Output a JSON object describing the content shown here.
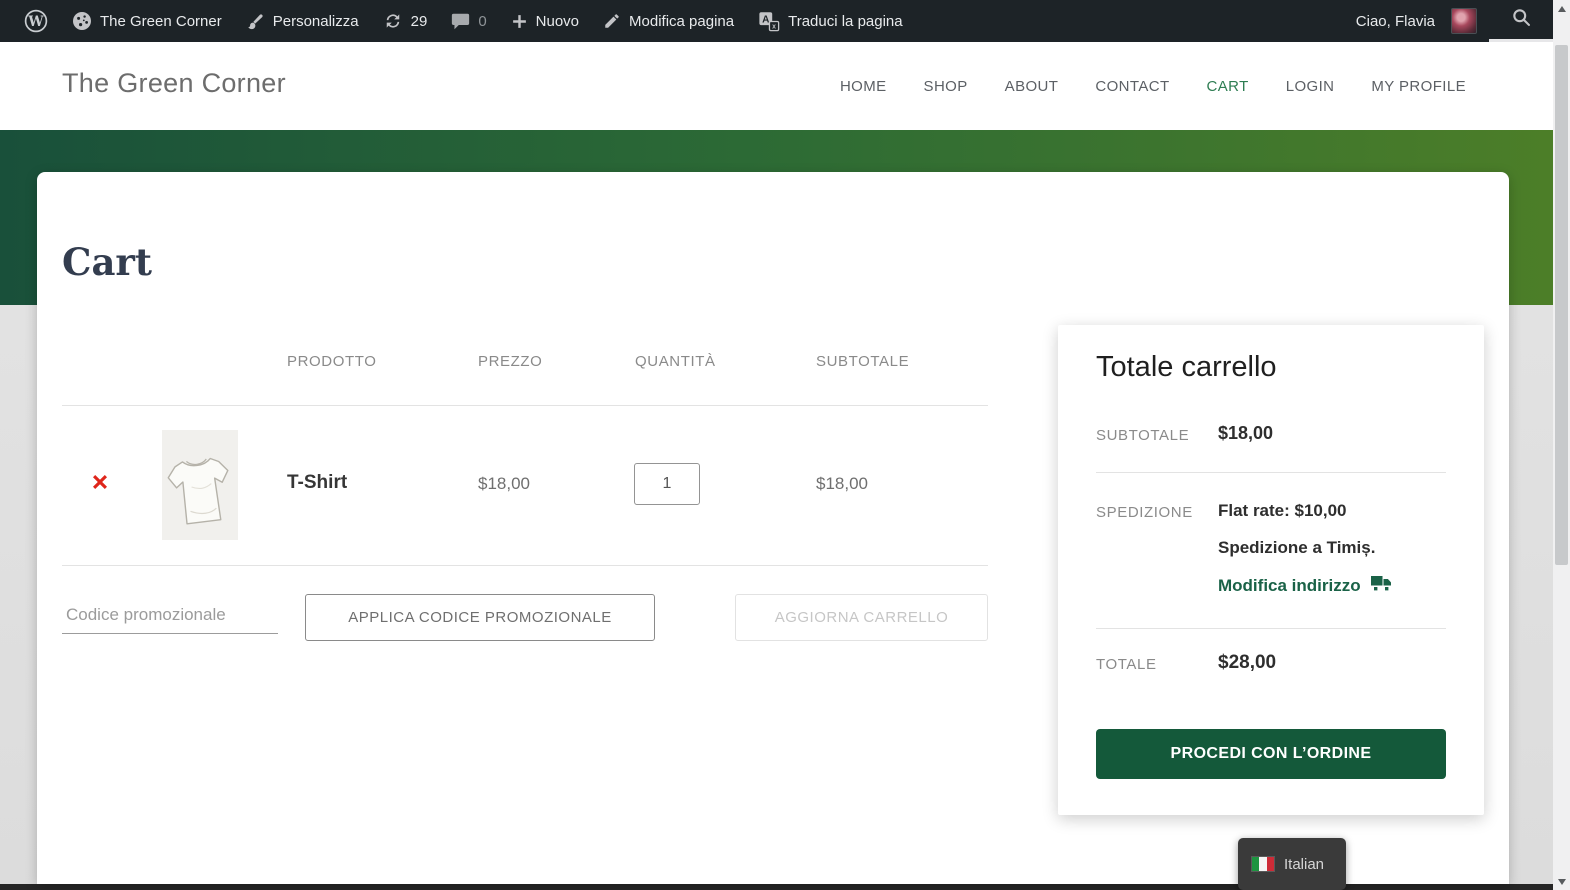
{
  "admin_bar": {
    "site_name": "The Green Corner",
    "customize_label": "Personalizza",
    "updates_count": "29",
    "comments_count": "0",
    "new_label": "Nuovo",
    "edit_page_label": "Modifica pagina",
    "translate_label": "Traduci la pagina",
    "greeting": "Ciao, Flavia"
  },
  "header": {
    "site_title": "The Green Corner",
    "nav": [
      {
        "label": "HOME",
        "active": false
      },
      {
        "label": "SHOP",
        "active": false
      },
      {
        "label": "ABOUT",
        "active": false
      },
      {
        "label": "CONTACT",
        "active": false
      },
      {
        "label": "CART",
        "active": true
      },
      {
        "label": "LOGIN",
        "active": false
      },
      {
        "label": "MY PROFILE",
        "active": false
      }
    ]
  },
  "cart": {
    "title": "Cart",
    "columns": [
      "PRODOTTO",
      "PREZZO",
      "QUANTITÀ",
      "SUBTOTALE"
    ],
    "items": [
      {
        "name": "T-Shirt",
        "price": "$18,00",
        "quantity": "1",
        "subtotal": "$18,00"
      }
    ],
    "coupon_placeholder": "Codice promozionale",
    "apply_coupon_label": "APPLICA CODICE PROMOZIONALE",
    "update_cart_label": "AGGIORNA CARRELLO"
  },
  "totals": {
    "title": "Totale carrello",
    "subtotal_label": "SUBTOTALE",
    "subtotal_value": "$18,00",
    "shipping_label": "SPEDIZIONE",
    "shipping_method": "Flat rate: $10,00",
    "shipping_destination": "Spedizione a Timiș.",
    "change_address_label": "Modifica indirizzo",
    "total_label": "TOTALE",
    "total_value": "$28,00",
    "checkout_label": "PROCEDI CON L’ORDINE"
  },
  "language_switcher": {
    "label": "Italian",
    "flag": "italian-flag"
  },
  "icons": {
    "wp_logo": "wordpress-logo",
    "site": "gauge-dashboard",
    "customize": "paintbrush",
    "updates": "refresh-arrows",
    "comments": "speech-bubble",
    "new": "plus",
    "edit": "pencil",
    "translate": "translate-squares",
    "search": "magnifier",
    "remove": "red-x",
    "shipping": "truck"
  },
  "colors": {
    "admin_bar_bg": "#1d2327",
    "hero_gradient_left": "#19503a",
    "hero_gradient_right": "#4c7e28",
    "nav_active_green": "#2e7d52",
    "link_green": "#1a6247",
    "checkout_green": "#14593a",
    "remove_red": "#df251b"
  }
}
